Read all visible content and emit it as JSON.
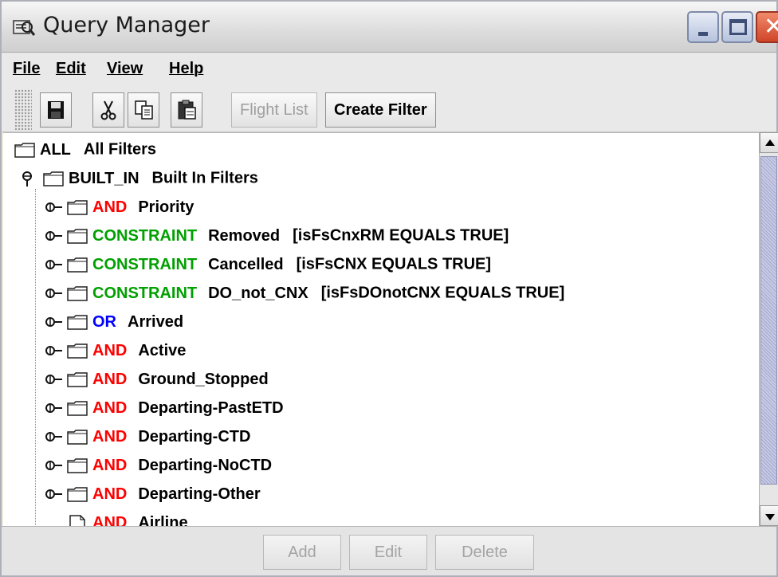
{
  "window": {
    "title": "Query Manager",
    "title_icon": "query-manager-icon"
  },
  "menu": [
    "File",
    "Edit",
    "View",
    "Help"
  ],
  "toolbar": {
    "icons": [
      "save-icon",
      "cut-icon",
      "copy-icon",
      "paste-icon"
    ],
    "flight_list_label": "Flight List",
    "create_filter_label": "Create Filter"
  },
  "tree": {
    "root": {
      "code": "ALL",
      "label": "All Filters"
    },
    "builtin": {
      "code": "BUILT_IN",
      "label": "Built In Filters"
    },
    "items": [
      {
        "op": "AND",
        "label": "Priority",
        "cond": ""
      },
      {
        "op": "CONSTRAINT",
        "label": "Removed",
        "cond": "[isFsCnxRM EQUALS TRUE]"
      },
      {
        "op": "CONSTRAINT",
        "label": "Cancelled",
        "cond": "[isFsCNX EQUALS TRUE]"
      },
      {
        "op": "CONSTRAINT",
        "label": "DO_not_CNX",
        "cond": "[isFsDOnotCNX EQUALS TRUE]"
      },
      {
        "op": "OR",
        "label": "Arrived",
        "cond": ""
      },
      {
        "op": "AND",
        "label": "Active",
        "cond": ""
      },
      {
        "op": "AND",
        "label": "Ground_Stopped",
        "cond": ""
      },
      {
        "op": "AND",
        "label": "Departing-PastETD",
        "cond": ""
      },
      {
        "op": "AND",
        "label": "Departing-CTD",
        "cond": ""
      },
      {
        "op": "AND",
        "label": "Departing-NoCTD",
        "cond": ""
      },
      {
        "op": "AND",
        "label": "Departing-Other",
        "cond": ""
      },
      {
        "op": "AND",
        "label": "Airline",
        "cond": ""
      }
    ]
  },
  "buttons": {
    "add": "Add",
    "edit": "Edit",
    "delete": "Delete"
  },
  "colors": {
    "and": "#ff0000",
    "or": "#0000ff",
    "constraint": "#00a000"
  }
}
